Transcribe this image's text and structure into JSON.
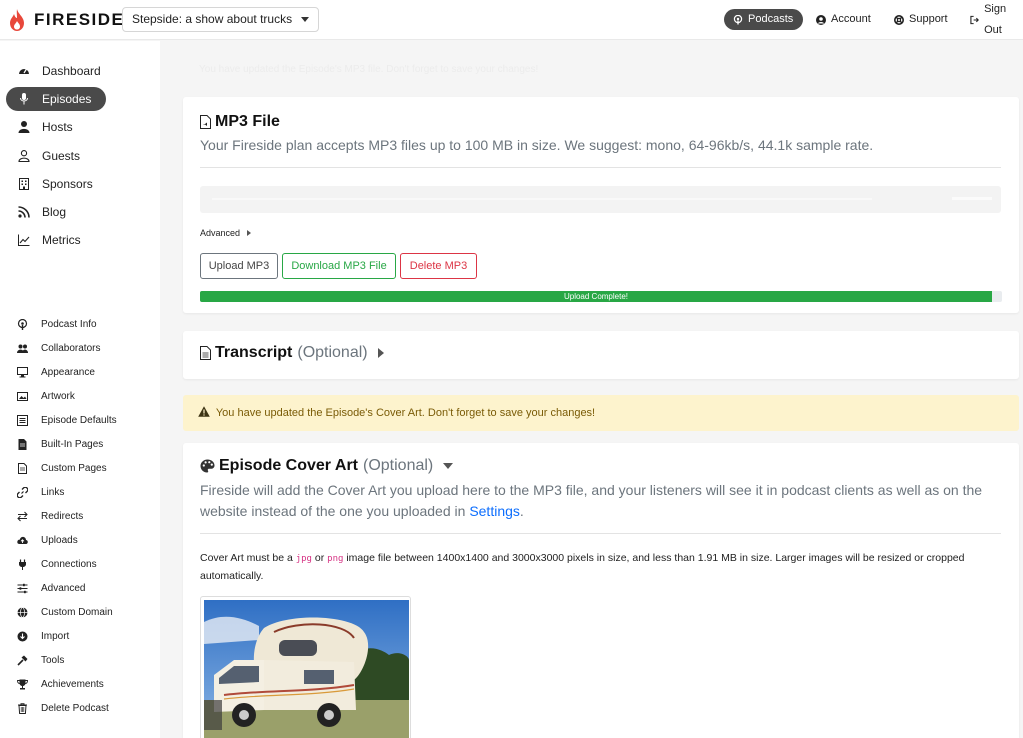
{
  "brand": {
    "name": "FIRESIDE",
    "accent": "#e8483b"
  },
  "show_selector": {
    "value": "Stepside: a show about trucks"
  },
  "topnav": {
    "podcasts": "Podcasts",
    "account": "Account",
    "support": "Support",
    "signout": "Sign Out"
  },
  "sidebar": {
    "main": [
      {
        "label": "Dashboard",
        "icon": "gauge-icon"
      },
      {
        "label": "Episodes",
        "icon": "microphone-icon",
        "active": true
      },
      {
        "label": "Hosts",
        "icon": "person-icon"
      },
      {
        "label": "Guests",
        "icon": "user-outline-icon"
      },
      {
        "label": "Sponsors",
        "icon": "building-icon"
      },
      {
        "label": "Blog",
        "icon": "rss-icon"
      },
      {
        "label": "Metrics",
        "icon": "chart-line-icon"
      }
    ],
    "settings": [
      {
        "label": "Podcast Info",
        "icon": "podcast-icon"
      },
      {
        "label": "Collaborators",
        "icon": "users-icon"
      },
      {
        "label": "Appearance",
        "icon": "desktop-icon"
      },
      {
        "label": "Artwork",
        "icon": "image-icon"
      },
      {
        "label": "Episode Defaults",
        "icon": "list-icon"
      },
      {
        "label": "Built-In Pages",
        "icon": "file-icon"
      },
      {
        "label": "Custom Pages",
        "icon": "file-lines-icon"
      },
      {
        "label": "Links",
        "icon": "link-icon"
      },
      {
        "label": "Redirects",
        "icon": "arrows-icon"
      },
      {
        "label": "Uploads",
        "icon": "cloud-upload-icon"
      },
      {
        "label": "Connections",
        "icon": "plug-icon"
      },
      {
        "label": "Advanced",
        "icon": "sliders-icon"
      },
      {
        "label": "Custom Domain",
        "icon": "globe-icon"
      },
      {
        "label": "Import",
        "icon": "import-icon"
      },
      {
        "label": "Tools",
        "icon": "hammer-icon"
      },
      {
        "label": "Achievements",
        "icon": "trophy-icon"
      },
      {
        "label": "Delete Podcast",
        "icon": "trash-icon"
      }
    ]
  },
  "faded_alert": "You have updated the Episode's MP3 file. Don't forget to save your changes!",
  "mp3": {
    "title": "MP3 File",
    "description": "Your Fireside plan accepts MP3 files up to 100 MB in size. We suggest: mono, 64-96kb/s, 44.1k sample rate.",
    "advanced_label": "Advanced",
    "upload_btn": "Upload MP3",
    "download_btn": "Download MP3 File",
    "delete_btn": "Delete MP3",
    "progress_label": "Upload Complete!",
    "progress_fraction": 0.988
  },
  "transcript": {
    "title": "Transcript",
    "optional": "(Optional)"
  },
  "warning": "You have updated the Episode's Cover Art. Don't forget to save your changes!",
  "cover": {
    "title": "Episode Cover Art",
    "optional": "(Optional)",
    "desc_prefix": "Fireside will add the Cover Art you upload here to the MP3 file, and your listeners will see it in podcast clients as well as on the website instead of the one you uploaded in ",
    "desc_link": "Settings",
    "desc_suffix": ".",
    "req_1": "Cover Art must be a ",
    "code_jpg": "jpg",
    "req_or": " or ",
    "code_png": "png",
    "req_2": " image file between 1400x1400 and 3000x3000 pixels in size, and less than 1.91 MB in size. Larger images will be resized or cropped automatically."
  },
  "colors": {
    "success": "#28a745",
    "danger": "#dc3545",
    "link": "#0d6efd",
    "code": "#d63384",
    "warning_bg": "#fdf3cd"
  }
}
